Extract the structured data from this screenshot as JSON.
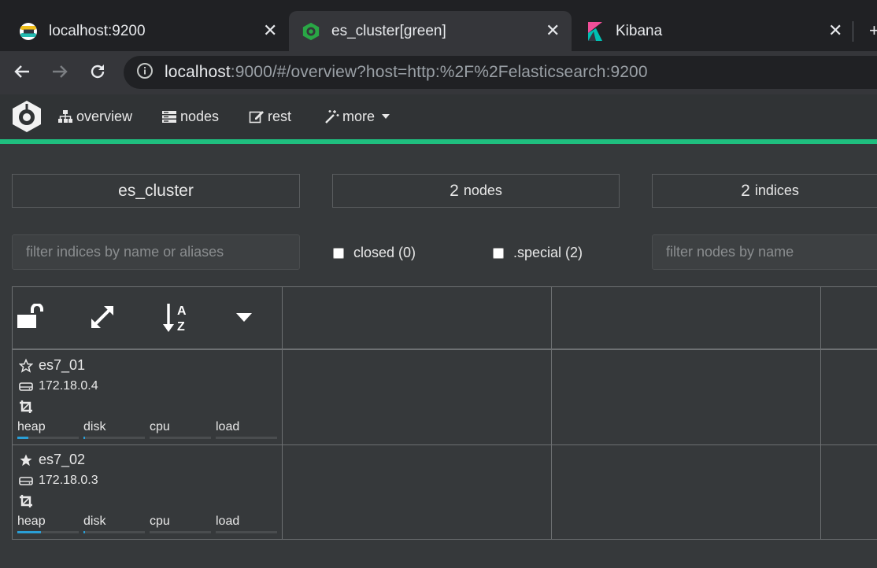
{
  "browser": {
    "tabs": [
      {
        "title": "localhost:9200",
        "icon": "elastic-icon"
      },
      {
        "title": "es_cluster[green]",
        "icon": "cerebro-icon"
      },
      {
        "title": "Kibana",
        "icon": "kibana-icon"
      }
    ],
    "url_host": "localhost",
    "url_rest": ":9000/#/overview?host=http:%2F%2Felasticsearch:9200"
  },
  "nav": {
    "overview": "overview",
    "nodes": "nodes",
    "rest": "rest",
    "more": "more"
  },
  "summary": {
    "cluster_name": "es_cluster",
    "nodes_count": "2",
    "nodes_label": "nodes",
    "indices_count": "2",
    "indices_label": "indices"
  },
  "filters": {
    "indices_placeholder": "filter indices by name or aliases",
    "closed_label": "closed (0)",
    "special_label": ".special (2)",
    "nodes_placeholder": "filter nodes by name"
  },
  "nodes": [
    {
      "name": "es7_01",
      "ip": "172.18.0.4",
      "master": false,
      "metrics": {
        "heap": "heap",
        "disk": "disk",
        "cpu": "cpu",
        "load": "load"
      },
      "heap_pct": 18,
      "disk_pct": 2,
      "cpu_pct": 0,
      "load_pct": 0
    },
    {
      "name": "es7_02",
      "ip": "172.18.0.3",
      "master": true,
      "metrics": {
        "heap": "heap",
        "disk": "disk",
        "cpu": "cpu",
        "load": "load"
      },
      "heap_pct": 38,
      "disk_pct": 2,
      "cpu_pct": 0,
      "load_pct": 0
    }
  ],
  "colors": {
    "accent": "#1fbf7f",
    "bar_fill": "#2a9fd6"
  }
}
